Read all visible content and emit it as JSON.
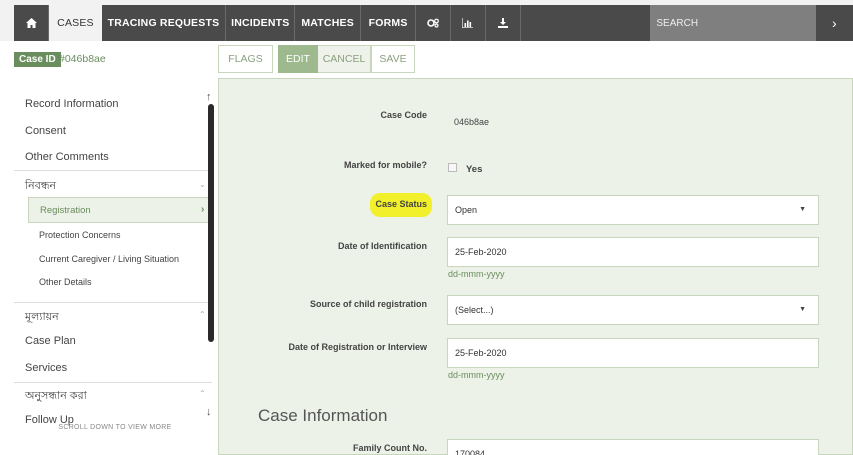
{
  "nav": {
    "home_icon": "home-icon",
    "items": [
      "CASES",
      "TRACING REQUESTS",
      "INCIDENTS",
      "MATCHES",
      "FORMS"
    ],
    "tools_icons": [
      "gears-icon",
      "bar-chart-icon",
      "download-icon"
    ],
    "search_placeholder": "SEARCH",
    "go_symbol": "›"
  },
  "header": {
    "case_id_label": "Case ID",
    "case_id_value": "#046b8ae",
    "buttons": {
      "flags": "FLAGS",
      "edit": "EDIT",
      "cancel": "CANCEL",
      "save": "SAVE"
    }
  },
  "sidebar": {
    "top_items": [
      "Record Information",
      "Consent",
      "Other Comments"
    ],
    "section1": "নিবন্ধন",
    "active_sub": "Registration",
    "subs": [
      "Protection Concerns",
      "Current Caregiver / Living Situation",
      "Other Details"
    ],
    "section2": "মূল্যায়ন",
    "mid_items": [
      "Case Plan",
      "Services"
    ],
    "section3": "অনুসন্ধান করা",
    "partial_item": "Follow Up",
    "scroll_hint": "SCROLL DOWN TO VIEW MORE"
  },
  "form": {
    "case_code_label": "Case Code",
    "case_code_value": "046b8ae",
    "mobile_label": "Marked for mobile?",
    "mobile_option": "Yes",
    "status_label": "Case Status",
    "status_value": "Open",
    "doi_label": "Date of Identification",
    "doi_value": "25-Feb-2020",
    "date_hint": "dd-mmm-yyyy",
    "source_label": "Source of child registration",
    "source_value": "(Select...)",
    "dor_label": "Date of Registration or Interview",
    "dor_value": "25-Feb-2020",
    "section_title": "Case Information",
    "family_label": "Family Count No.",
    "family_value": "170084"
  },
  "colors": {
    "accent": "#6a8d5e",
    "panel": "#edf2e8",
    "nav": "#4a4a4a",
    "highlight": "#f2f02a"
  }
}
